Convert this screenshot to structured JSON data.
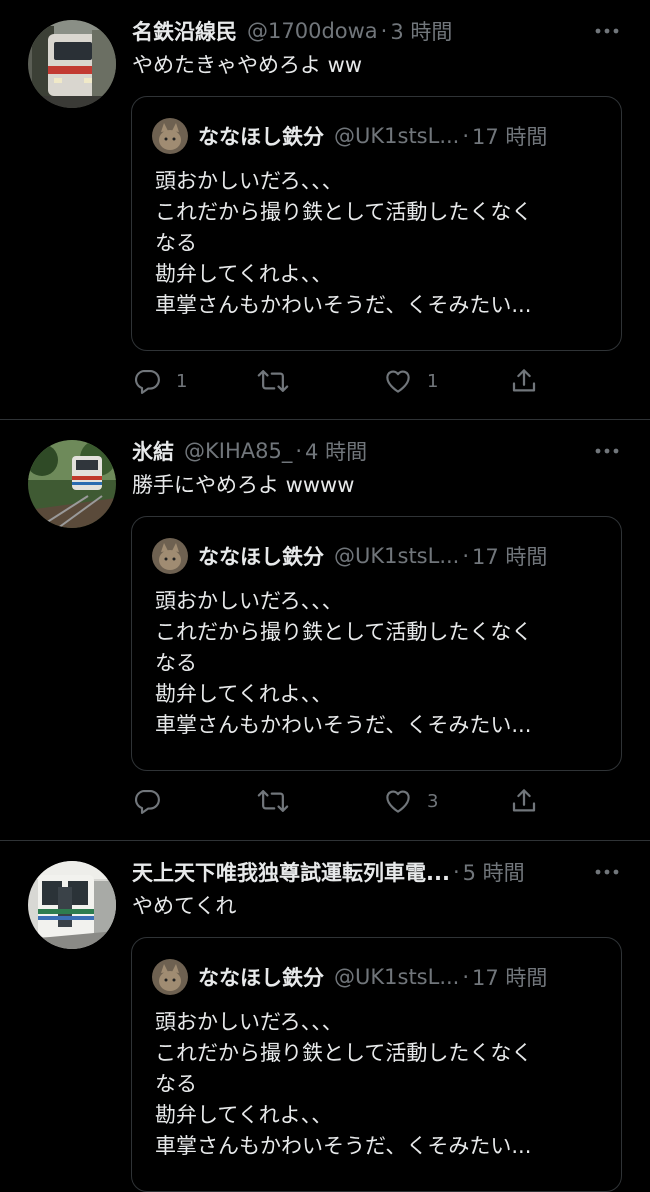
{
  "colors": {
    "background": "#000000",
    "text": "#e7e9ea",
    "muted": "#71767b",
    "border": "#2f3336"
  },
  "tweets": [
    {
      "name": "名鉄沿線民",
      "handle": "@1700dowa",
      "dot": "·",
      "time": "3 時間",
      "text": "やめたきゃやめろよ ww",
      "avatar_icon": "train-photo-avatar",
      "quote": {
        "name": "ななほし鉄分",
        "handle": "@UK1stsL...",
        "dot": "·",
        "time": "17 時間",
        "lines": [
          "頭おかしいだろ、、、",
          "これだから撮り鉄として活動したくなく",
          "なる",
          "勘弁してくれよ、、",
          "車掌さんもかわいそうだ、くそみたい..."
        ]
      },
      "actions": {
        "reply_count": "1",
        "retweet_count": "",
        "like_count": "1"
      }
    },
    {
      "name": "氷結",
      "handle": "@KIHA85_",
      "dot": "·",
      "time": "4 時間",
      "text": "勝手にやめろよ wwww",
      "avatar_icon": "train-photo-avatar",
      "quote": {
        "name": "ななほし鉄分",
        "handle": "@UK1stsL...",
        "dot": "·",
        "time": "17 時間",
        "lines": [
          "頭おかしいだろ、、、",
          "これだから撮り鉄として活動したくなく",
          "なる",
          "勘弁してくれよ、、",
          "車掌さんもかわいそうだ、くそみたい..."
        ]
      },
      "actions": {
        "reply_count": "",
        "retweet_count": "",
        "like_count": "3"
      }
    },
    {
      "name": "天上天下唯我独尊試運転列車電...",
      "handle": "",
      "dot": "·",
      "time": "5 時間",
      "text": "やめてくれ",
      "avatar_icon": "train-photo-avatar",
      "quote": {
        "name": "ななほし鉄分",
        "handle": "@UK1stsL...",
        "dot": "·",
        "time": "17 時間",
        "lines": [
          "頭おかしいだろ、、、",
          "これだから撮り鉄として活動したくなく",
          "なる",
          "勘弁してくれよ、、",
          "車掌さんもかわいそうだ、くそみたい..."
        ]
      },
      "actions": {
        "reply_count": "",
        "retweet_count": "",
        "like_count": ""
      }
    }
  ],
  "icons": {
    "more": "more-horizontal-icon",
    "reply": "reply-icon",
    "retweet": "retweet-icon",
    "like": "heart-icon",
    "share": "share-icon"
  }
}
